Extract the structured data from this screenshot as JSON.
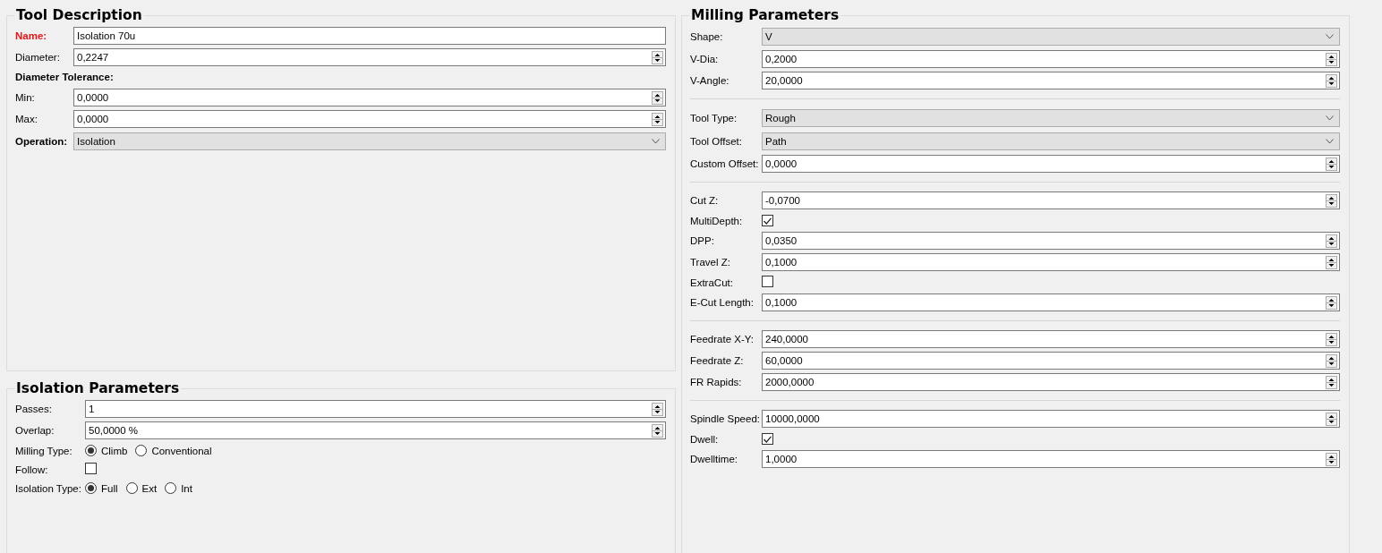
{
  "tool_description": {
    "title": "Tool Description",
    "rows": [
      {
        "kind": "text",
        "label": "Name:",
        "value": "Isolation 70u",
        "required": true,
        "bold": true
      },
      {
        "kind": "spin",
        "label": "Diameter:",
        "value": "0,2247",
        "required": false,
        "bold": false
      },
      {
        "kind": "heading",
        "label": "Diameter Tolerance:"
      },
      {
        "kind": "spin",
        "label": "Min:",
        "value": "0,0000",
        "required": false,
        "bold": false
      },
      {
        "kind": "spin",
        "label": "Max:",
        "value": "0,0000",
        "required": false,
        "bold": false
      },
      {
        "kind": "select",
        "label": "Operation:",
        "value": "Isolation",
        "required": false,
        "bold": true
      }
    ]
  },
  "isolation_parameters": {
    "title": "Isolation Parameters",
    "rows": [
      {
        "kind": "spin",
        "label": "Passes:",
        "value": "1"
      },
      {
        "kind": "spin",
        "label": "Overlap:",
        "value": "50,0000 %"
      },
      {
        "kind": "radio",
        "label": "Milling Type:",
        "options": [
          {
            "label": "Climb",
            "selected": true
          },
          {
            "label": "Conventional",
            "selected": false
          }
        ]
      },
      {
        "kind": "checkbox",
        "label": "Follow:",
        "checked": false
      },
      {
        "kind": "radio",
        "label": "Isolation Type:",
        "options": [
          {
            "label": "Full",
            "selected": true
          },
          {
            "label": "Ext",
            "selected": false
          },
          {
            "label": "Int",
            "selected": false
          }
        ]
      }
    ]
  },
  "milling_parameters": {
    "title": "Milling Parameters",
    "rows": [
      {
        "kind": "select",
        "label": "Shape:",
        "value": "V"
      },
      {
        "kind": "spin",
        "label": "V-Dia:",
        "value": "0,2000"
      },
      {
        "kind": "spin",
        "label": "V-Angle:",
        "value": "20,0000"
      },
      {
        "kind": "separator"
      },
      {
        "kind": "select",
        "label": "Tool Type:",
        "value": "Rough"
      },
      {
        "kind": "select",
        "label": "Tool Offset:",
        "value": "Path"
      },
      {
        "kind": "spin",
        "label": "Custom Offset:",
        "value": "0,0000"
      },
      {
        "kind": "separator"
      },
      {
        "kind": "spin",
        "label": "Cut Z:",
        "value": "-0,0700"
      },
      {
        "kind": "checkbox",
        "label": "MultiDepth:",
        "checked": true
      },
      {
        "kind": "spin",
        "label": "DPP:",
        "value": "0,0350"
      },
      {
        "kind": "spin",
        "label": "Travel Z:",
        "value": "0,1000"
      },
      {
        "kind": "checkbox",
        "label": "ExtraCut:",
        "checked": false
      },
      {
        "kind": "spin",
        "label": "E-Cut Length:",
        "value": "0,1000"
      },
      {
        "kind": "separator"
      },
      {
        "kind": "spin",
        "label": "Feedrate X-Y:",
        "value": "240,0000"
      },
      {
        "kind": "spin",
        "label": "Feedrate Z:",
        "value": "60,0000"
      },
      {
        "kind": "spin",
        "label": "FR Rapids:",
        "value": "2000,0000"
      },
      {
        "kind": "separator"
      },
      {
        "kind": "spin",
        "label": "Spindle Speed:",
        "value": "10000,0000"
      },
      {
        "kind": "checkbox",
        "label": "Dwell:",
        "checked": true
      },
      {
        "kind": "spin",
        "label": "Dwelltime:",
        "value": "1,0000"
      }
    ]
  }
}
